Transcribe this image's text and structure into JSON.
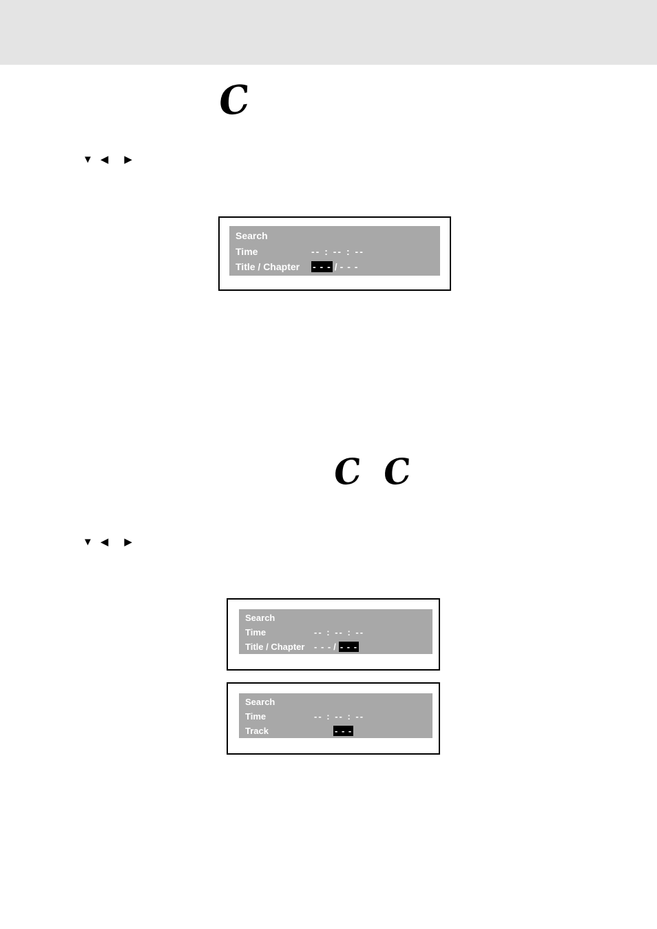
{
  "page": {
    "header_band_color": "#e4e4e4",
    "background_color": "#ffffff"
  },
  "annotations": {
    "marks": [
      {
        "name": "c-mark-top",
        "glyph": "C"
      },
      {
        "name": "c-mark-middle-left",
        "glyph": "C"
      },
      {
        "name": "c-mark-middle-right",
        "glyph": "C"
      }
    ]
  },
  "arrow_rows": [
    {
      "name": "arrow-row-top",
      "glyphs": [
        "▼",
        "◀",
        "▶"
      ]
    },
    {
      "name": "arrow-row-bottom",
      "glyphs": [
        "▼",
        "◀",
        "▶"
      ]
    }
  ],
  "osd_panels": [
    {
      "name": "osd-search-title-chapter-highlight-title",
      "title": "Search",
      "rows": [
        {
          "label": "Time",
          "value": "-- : -- : --",
          "highlight": null
        },
        {
          "label": "Title / Chapter",
          "value_pre": "- - -",
          "separator": "/",
          "value_post": "- - -",
          "highlight": "pre"
        }
      ]
    },
    {
      "name": "osd-search-title-chapter-highlight-chapter",
      "title": "Search",
      "rows": [
        {
          "label": "Time",
          "value": "-- : -- : --",
          "highlight": null
        },
        {
          "label": "Title / Chapter",
          "value_pre": "- - -",
          "separator": "/",
          "value_post": "- - -",
          "highlight": "post"
        }
      ]
    },
    {
      "name": "osd-search-track",
      "title": "Search",
      "rows": [
        {
          "label": "Time",
          "value": "-- : -- : --",
          "highlight": null
        },
        {
          "label": "Track",
          "value": "- - -",
          "highlight": "value"
        }
      ]
    }
  ]
}
